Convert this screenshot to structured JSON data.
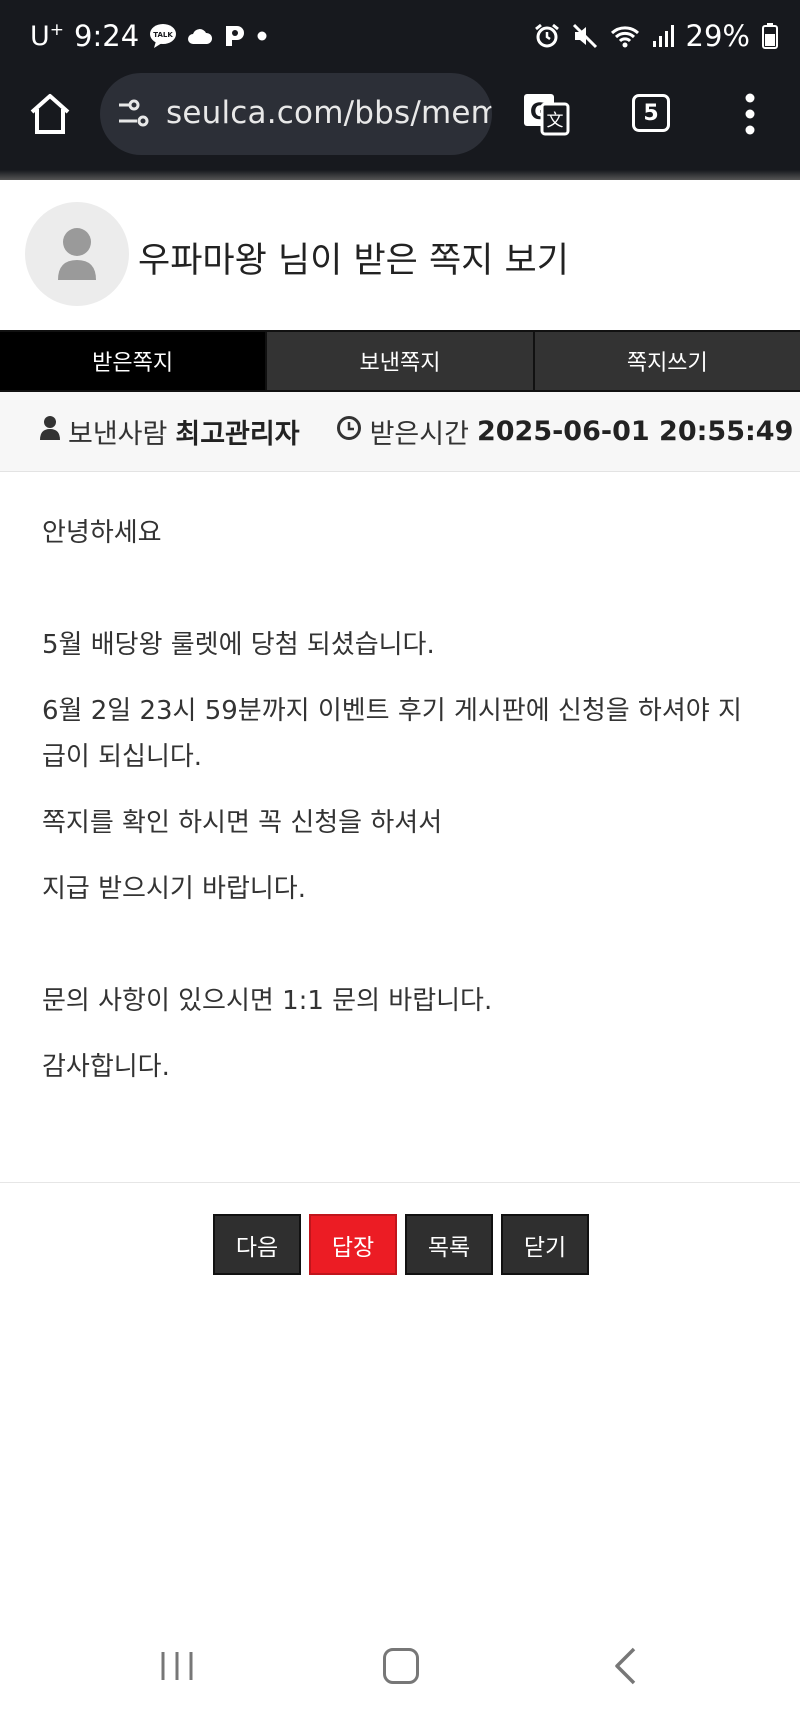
{
  "status_bar": {
    "carrier": "U",
    "carrier_super": "+",
    "time": "9:24",
    "battery": "29%",
    "icons": [
      "talk-icon",
      "cloud-icon",
      "p-app-icon",
      "dot-icon",
      "alarm-icon",
      "mute-icon",
      "wifi-icon",
      "signal-icon",
      "battery-icon"
    ]
  },
  "browser": {
    "url": "seulca.com/bbs/memo_view",
    "tab_count": "5",
    "icons": [
      "home-icon",
      "site-settings-icon",
      "translate-icon",
      "tabs-icon",
      "more-menu-icon"
    ]
  },
  "header": {
    "title": "우파마왕 님이 받은 쪽지 보기",
    "avatar_icon": "user-avatar-icon"
  },
  "tabs": [
    {
      "label": "받은쪽지",
      "active": true
    },
    {
      "label": "보낸쪽지",
      "active": false
    },
    {
      "label": "쪽지쓰기",
      "active": false
    }
  ],
  "info": {
    "sender_label": "보낸사람",
    "sender": "최고관리자",
    "received_label": "받은시간",
    "received_time": "2025-06-01 20:55:49"
  },
  "message": {
    "line1": "안녕하세요",
    "line2": "5월 배당왕 룰렛에 당첨 되셨습니다.",
    "line3": "6월 2일 23시 59분까지 이벤트 후기 게시판에 신청을 하셔야 지급이 되십니다.",
    "line4": "쪽지를 확인 하시면 꼭 신청을 하셔서",
    "line5": "지급 받으시기 바랍니다.",
    "line6": "문의 사항이 있으시면 1:1 문의 바랍니다.",
    "line7": "감사합니다."
  },
  "actions": {
    "next": "다음",
    "reply": "답장",
    "list": "목록",
    "close": "닫기"
  },
  "colors": {
    "chrome_bg": "#17191e",
    "tab_active": "#000000",
    "tab_inactive": "#333333",
    "reply_button": "#ec1c24",
    "button_dark": "#2f2f2f"
  }
}
